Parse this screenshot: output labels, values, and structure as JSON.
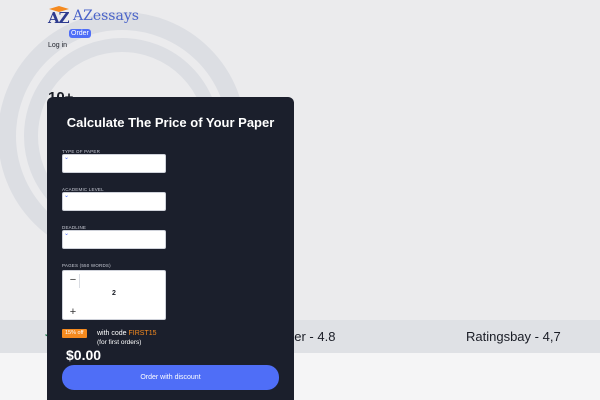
{
  "header": {
    "logo_mark": "AZ",
    "logo_text": "AZessays",
    "order_label": "Order",
    "login_label": "Log in"
  },
  "hero": {
    "heading_fragment": "10+"
  },
  "calculator": {
    "title": "Calculate The Price of Your Paper",
    "fields": {
      "type_of_paper": {
        "label": "TYPE OF PAPER",
        "value": ""
      },
      "academic_level": {
        "label": "ACADEMIC LEVEL",
        "value": ""
      },
      "deadline": {
        "label": "DEADLINE",
        "value": ""
      }
    },
    "pages": {
      "label": "PAGES (550 WORDS)",
      "value": "2",
      "minus": "−",
      "plus": "+"
    },
    "promo": {
      "badge": "15% off",
      "text": "with code",
      "code": "FIRST15",
      "note": "(for first orders)"
    },
    "price": "$0.00",
    "cta_label": "Order with discount"
  },
  "ratings": [
    {
      "name": "ber",
      "score": "- 4.8"
    },
    {
      "name": "Ratingsbay",
      "score": "- 4,7"
    }
  ],
  "colors": {
    "accent": "#4f6ef7",
    "promo": "#f58a1f",
    "panel": "#1b1f2c",
    "background": "#ebebed"
  }
}
